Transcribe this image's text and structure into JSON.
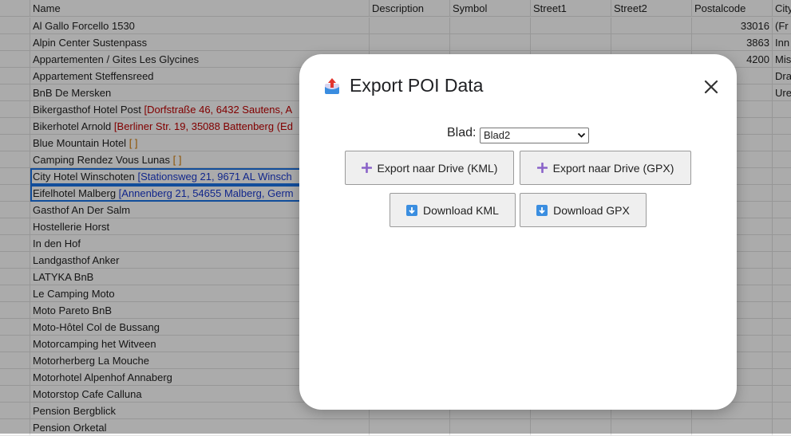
{
  "sheet": {
    "headers": [
      "Name",
      "Description",
      "Symbol",
      "Street1",
      "Street2",
      "Postalcode",
      "City"
    ],
    "rows": [
      {
        "name": "Al Gallo Forcello 1530",
        "addr": "",
        "postal": "33016",
        "city": " (Fr"
      },
      {
        "name": "Alpin Center Sustenpass",
        "addr": "",
        "postal": "3863",
        "city": "Inn"
      },
      {
        "name": "Appartementen / Gites Les Glycines",
        "addr": "",
        "postal": "4200",
        "city": "Mis"
      },
      {
        "name": "Appartement Steffensreed",
        "addr": "",
        "postal": "",
        "city": "Dra"
      },
      {
        "name": "BnB De Mersken",
        "addr": "",
        "postal": "",
        "city": "Ure"
      },
      {
        "name": "Bikergasthof Hotel Post ",
        "addr": "[Dorfstraße 46, 6432 Sautens, A",
        "postal": "",
        "city": ""
      },
      {
        "name": "Bikerhotel Arnold ",
        "addr": "[Berliner Str. 19, 35088 Battenberg (Ed",
        "postal": "",
        "city": ""
      },
      {
        "name": "Blue Mountain Hotel ",
        "addr": "[ ]",
        "postal": "",
        "city": ""
      },
      {
        "name": "Camping Rendez Vous Lunas ",
        "addr": "[ ]",
        "postal": "",
        "city": ""
      },
      {
        "name": "City Hotel Winschoten ",
        "addr": "[Stationsweg 21, 9671 AL Winsch",
        "postal": "",
        "city": ""
      },
      {
        "name": "Eifelhotel Malberg ",
        "addr": "[Annenberg 21, 54655 Malberg, Germ",
        "postal": "",
        "city": ""
      },
      {
        "name": "Gasthof An Der Salm",
        "addr": "",
        "postal": "",
        "city": ""
      },
      {
        "name": "Hostellerie Horst",
        "addr": "",
        "postal": "",
        "city": ""
      },
      {
        "name": "In den Hof",
        "addr": "",
        "postal": "",
        "city": ""
      },
      {
        "name": "Landgasthof Anker",
        "addr": "",
        "postal": "",
        "city": ""
      },
      {
        "name": "LATYKA BnB",
        "addr": "",
        "postal": "",
        "city": ""
      },
      {
        "name": "Le Camping Moto",
        "addr": "",
        "postal": "",
        "city": ""
      },
      {
        "name": "Moto Pareto BnB",
        "addr": "",
        "postal": "",
        "city": ""
      },
      {
        "name": "Moto-Hôtel Col de Bussang",
        "addr": "",
        "postal": "",
        "city": ""
      },
      {
        "name": "Motorcamping het Witveen",
        "addr": "",
        "postal": "",
        "city": ""
      },
      {
        "name": "Motorherberg La Mouche",
        "addr": "",
        "postal": "",
        "city": ""
      },
      {
        "name": "Motorhotel Alpenhof Annaberg",
        "addr": "",
        "postal": "",
        "city": ""
      },
      {
        "name": "Motorstop Cafe Calluna",
        "addr": "",
        "postal": "",
        "city": ""
      },
      {
        "name": "Pension Bergblick",
        "addr": "",
        "postal": "",
        "city": ""
      },
      {
        "name": "Pension Orketal",
        "addr": "",
        "postal": "",
        "city": ""
      }
    ]
  },
  "dialog": {
    "title": "Export POI Data",
    "icon": "export-upload-icon",
    "blad_label": "Blad:",
    "blad_value": "Blad2",
    "buttons": {
      "export_kml": "Export naar Drive (KML)",
      "export_gpx": "Export naar Drive (GPX)",
      "download_kml": "Download KML",
      "download_gpx": "Download GPX"
    }
  },
  "colors": {
    "addr_red": "#c00000",
    "addr_blue": "#1a3ad0",
    "addr_orange": "#d27a00",
    "plus_icon": "#8a63c9",
    "download_icon": "#3b8ee0",
    "selection": "#1a73e8"
  }
}
